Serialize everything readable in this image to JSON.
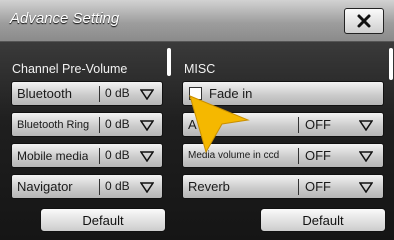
{
  "window": {
    "title": "Advance Setting",
    "close_icon": "close-icon"
  },
  "left_panel": {
    "title": "Channel Pre-Volume",
    "rows": [
      {
        "label": "Bluetooth",
        "value": "0 dB"
      },
      {
        "label": "Bluetooth Ring",
        "value": "0 dB"
      },
      {
        "label": "Mobile media",
        "value": "0 dB"
      },
      {
        "label": "Navigator",
        "value": "0 dB"
      }
    ],
    "default_label": "Default"
  },
  "right_panel": {
    "title": "MISC",
    "fade_in": {
      "label": "Fade in",
      "checked": false
    },
    "rows": [
      {
        "label": "A",
        "value": "OFF"
      },
      {
        "label": "Media volume in ccd",
        "value": "OFF"
      },
      {
        "label": "Reverb",
        "value": "OFF"
      }
    ],
    "default_label": "Default"
  },
  "colors": {
    "cursor": "#f5b800",
    "title_bar": "#a8a8a8",
    "background": "#1e1e1e"
  }
}
